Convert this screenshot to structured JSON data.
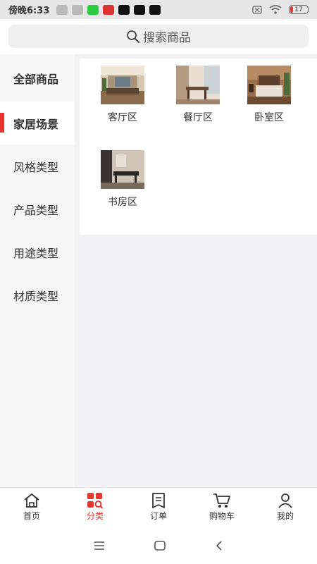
{
  "status_bar": {
    "time": "傍晚6:33",
    "battery": "17",
    "apps": [
      "message-icon",
      "message-icon",
      "iqiyi-icon",
      "news-icon",
      "tiktok-icon",
      "tiktok-icon",
      "tiktok-icon"
    ]
  },
  "search": {
    "placeholder": "搜索商品"
  },
  "sidebar": {
    "items": [
      {
        "label": "全部商品"
      },
      {
        "label": "家居场景"
      },
      {
        "label": "风格类型"
      },
      {
        "label": "产品类型"
      },
      {
        "label": "用途类型"
      },
      {
        "label": "材质类型"
      }
    ],
    "active_index": 1
  },
  "categories": [
    {
      "label": "客厅区",
      "image": "living-room-photo"
    },
    {
      "label": "餐厅区",
      "image": "dining-room-photo"
    },
    {
      "label": "卧室区",
      "image": "bedroom-photo"
    },
    {
      "label": "书房区",
      "image": "study-room-photo"
    }
  ],
  "tabbar": {
    "items": [
      {
        "label": "首页",
        "icon": "home-icon"
      },
      {
        "label": "分类",
        "icon": "category-icon"
      },
      {
        "label": "订单",
        "icon": "order-icon"
      },
      {
        "label": "购物车",
        "icon": "cart-icon"
      },
      {
        "label": "我的",
        "icon": "profile-icon"
      }
    ],
    "active_index": 1
  },
  "colors": {
    "accent": "#e8342f",
    "sidebar_bg": "#f6f6f6",
    "content_bg": "#f2f2f4"
  }
}
